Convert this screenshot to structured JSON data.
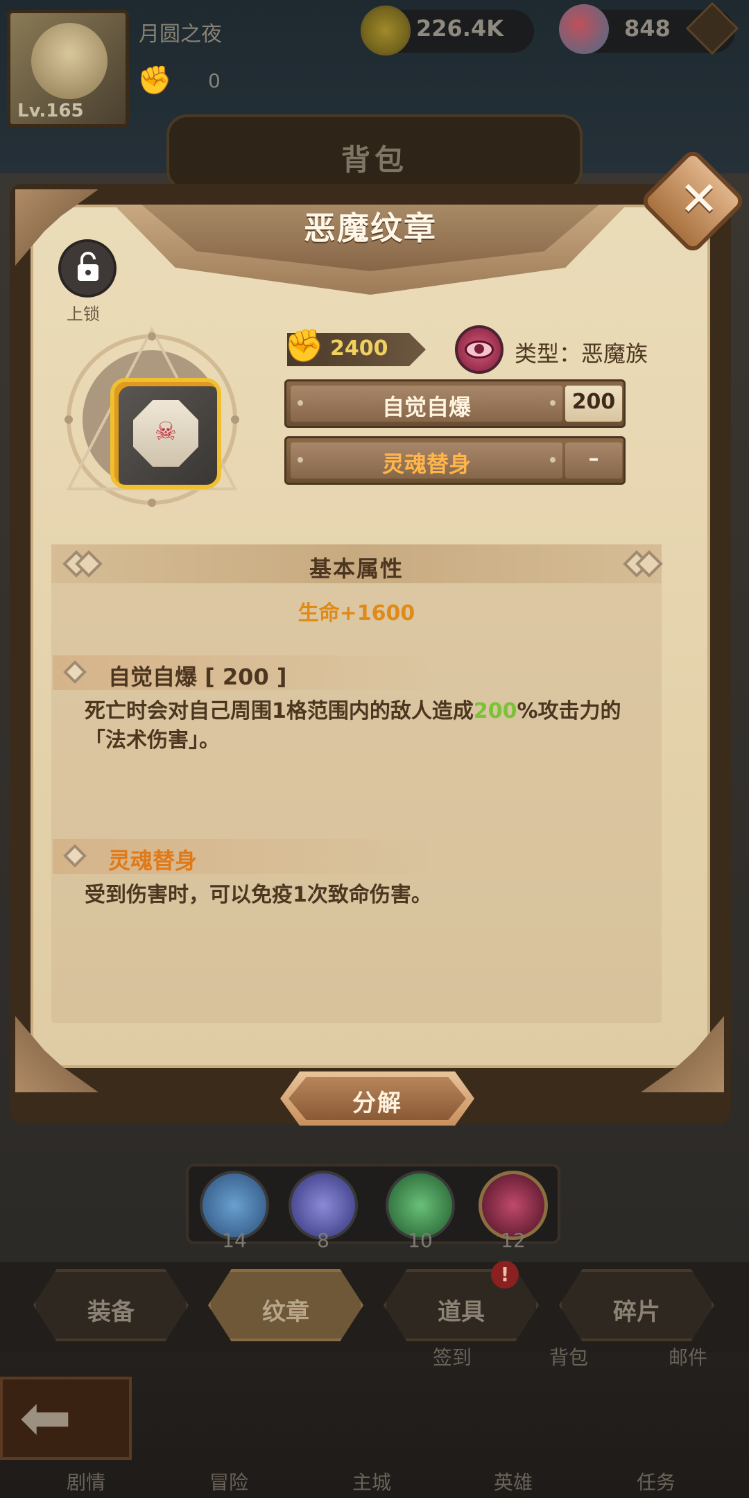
{
  "header": {
    "player_name": "月圆之夜",
    "level": "Lv.165",
    "stamina": "0",
    "gold": "226.4K",
    "gems": "848",
    "screen_title": "背包"
  },
  "dialog": {
    "title": "恶魔纹章",
    "lock_label": "上锁",
    "cost": "2400",
    "type_label": "类型：恶魔族",
    "skills": [
      {
        "name": "自觉自爆",
        "level": "200"
      },
      {
        "name": "灵魂替身",
        "level": "–"
      }
    ],
    "attributes_title": "基本属性",
    "attribute_line": "生命+1600",
    "sections": [
      {
        "title": "自觉自爆 [ 200 ]",
        "desc_before": "死亡时会对自己周围1格范围内的敌人造成",
        "desc_highlight": "200",
        "desc_after": "%攻击力的「法术伤害」。"
      },
      {
        "title": "灵魂替身",
        "desc": "受到伤害时，可以免疫1次致命伤害。"
      }
    ],
    "decompose_label": "分解"
  },
  "race_filter": [
    {
      "icon": "crown-icon",
      "count": "14",
      "color": "#4a7fb0"
    },
    {
      "icon": "ghost-icon",
      "count": "8",
      "color": "#5a5ab0"
    },
    {
      "icon": "moon-leaf-icon",
      "count": "10",
      "color": "#3a8a4a"
    },
    {
      "icon": "eye-icon",
      "count": "12",
      "color": "#8a2a4a"
    }
  ],
  "tabs": [
    {
      "label": "装备",
      "active": false
    },
    {
      "label": "纹章",
      "active": true
    },
    {
      "label": "道具",
      "active": false,
      "badge": "!"
    },
    {
      "label": "碎片",
      "active": false
    }
  ],
  "bottom_nav": {
    "signin": "签到",
    "bag": "背包",
    "mail": "邮件",
    "story": "剧情",
    "adventure": "冒险",
    "city": "主城",
    "hero": "英雄",
    "quest": "任务"
  }
}
